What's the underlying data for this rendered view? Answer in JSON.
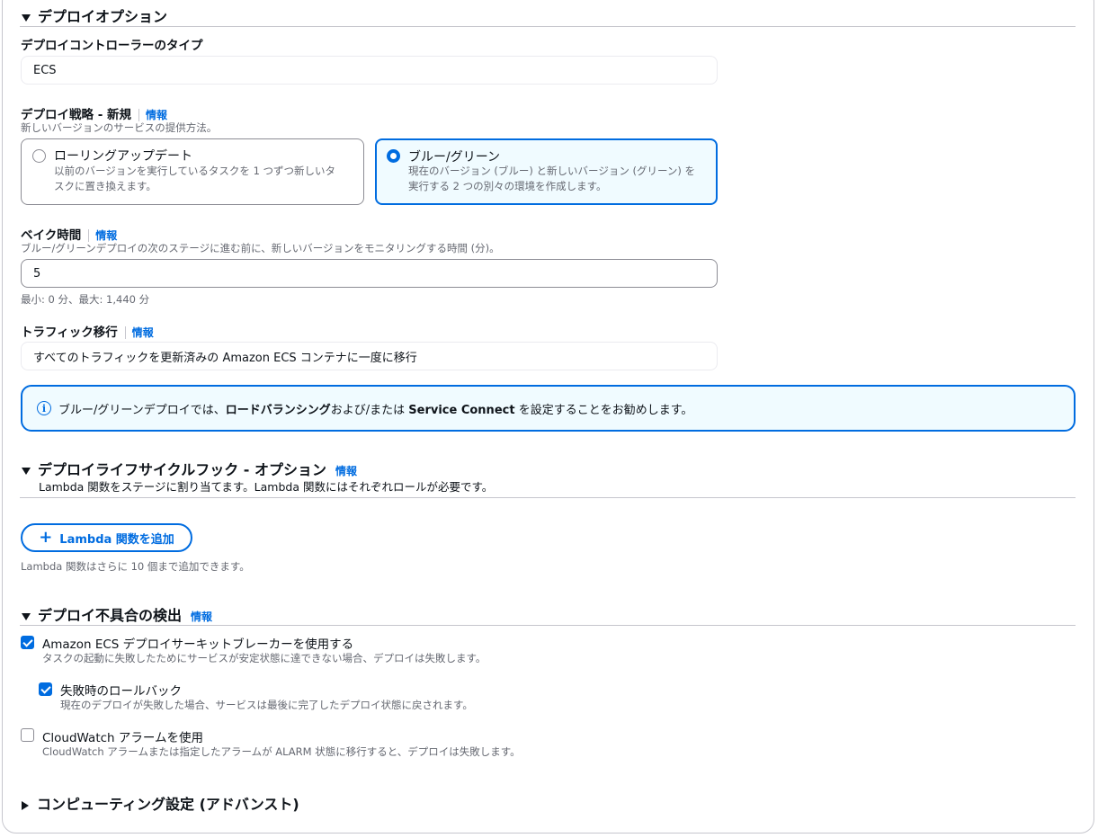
{
  "deploy_options": {
    "title": "デプロイオプション",
    "controller_type": {
      "label": "デプロイコントローラーのタイプ",
      "value": "ECS"
    },
    "strategy": {
      "label": "デプロイ戦略 - 新規",
      "info": "情報",
      "description": "新しいバージョンのサービスの提供方法。",
      "options": [
        {
          "title": "ローリングアップデート",
          "desc1": "以前のバージョンを実行しているタスクを 1 つずつ新しいタ",
          "desc2": "スクに置き換えます。",
          "selected": false
        },
        {
          "title": "ブルー/グリーン",
          "desc1": "現在のバージョン (ブルー) と新しいバージョン (グリーン) を",
          "desc2": "実行する 2 つの別々の環境を作成します。",
          "selected": true
        }
      ]
    },
    "bake_time": {
      "label": "ベイク時間",
      "info": "情報",
      "description": "ブルー/グリーンデプロイの次のステージに進む前に、新しいバージョンをモニタリングする時間 (分)。",
      "value": "5",
      "constraint": "最小: 0 分、最大: 1,440 分"
    },
    "traffic_shift": {
      "label": "トラフィック移行",
      "info": "情報",
      "value": "すべてのトラフィックを更新済みの Amazon ECS コンテナに一度に移行"
    },
    "alert": {
      "part1": "ブルー/グリーンデプロイでは、",
      "bold1": "ロードバランシング",
      "part2": "および/または ",
      "bold2": "Service Connect",
      "part3": " を設定することをお勧めします。"
    }
  },
  "lifecycle_hooks": {
    "title": "デプロイライフサイクルフック - オプション",
    "info": "情報",
    "description": "Lambda 関数をステージに割り当てます。Lambda 関数にはそれぞれロールが必要です。",
    "add_button": "Lambda 関数を追加",
    "hint": "Lambda 関数はさらに 10 個まで追加できます。"
  },
  "failure_detection": {
    "title": "デプロイ不具合の検出",
    "info": "情報",
    "circuit_breaker": {
      "label": "Amazon ECS デプロイサーキットブレーカーを使用する",
      "desc": "タスクの起動に失敗したためにサービスが安定状態に達できない場合、デプロイは失敗します。",
      "checked": true
    },
    "rollback": {
      "label": "失敗時のロールバック",
      "desc": "現在のデプロイが失敗した場合、サービスは最後に完了したデプロイ状態に戻されます。",
      "checked": true
    },
    "cloudwatch": {
      "label": "CloudWatch アラームを使用",
      "desc": "CloudWatch アラームまたは指定したアラームが ALARM 状態に移行すると、デプロイは失敗します。",
      "checked": false
    }
  },
  "compute": {
    "title": "コンピューティング設定 (アドバンスト)"
  },
  "colors": {
    "accent": "#006ce0",
    "text": "#0f141a",
    "muted": "#656871",
    "border": "#c6c6cd"
  }
}
